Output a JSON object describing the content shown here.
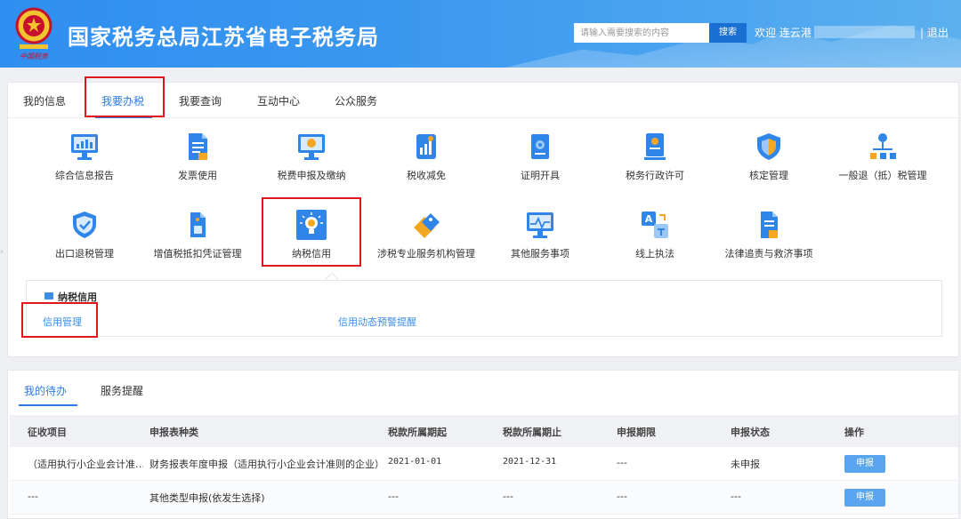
{
  "header": {
    "title": "国家税务总局江苏省电子税务局",
    "search_placeholder": "请输入需要搜索的内容",
    "search_button": "搜索",
    "welcome": "欢迎 连云港",
    "logout": "| 退出",
    "logo_text": "中国税务"
  },
  "nav": {
    "tabs": [
      "我的信息",
      "我要办税",
      "我要查询",
      "互动中心",
      "公众服务"
    ],
    "active": "我要办税"
  },
  "services": [
    {
      "label": "综合信息报告",
      "icon": "monitor-chart-icon"
    },
    {
      "label": "发票使用",
      "icon": "invoice-document-icon"
    },
    {
      "label": "税费申报及缴纳",
      "icon": "declare-monitor-icon"
    },
    {
      "label": "税收减免",
      "icon": "tax-relief-chart-icon"
    },
    {
      "label": "证明开具",
      "icon": "certificate-icon"
    },
    {
      "label": "税务行政许可",
      "icon": "permit-id-icon"
    },
    {
      "label": "核定管理",
      "icon": "shield-check-icon"
    },
    {
      "label": "一般退（抵）税管理",
      "icon": "org-tree-icon"
    },
    {
      "label": "出口退税管理",
      "icon": "shield-icon"
    },
    {
      "label": "增值税抵扣凭证管理",
      "icon": "voucher-doc-icon"
    },
    {
      "label": "纳税信用",
      "icon": "lightbulb-icon"
    },
    {
      "label": "涉税专业服务机构管理",
      "icon": "tags-icon"
    },
    {
      "label": "其他服务事项",
      "icon": "pulse-monitor-icon"
    },
    {
      "label": "线上执法",
      "icon": "translate-icon"
    },
    {
      "label": "法律追责与救济事项",
      "icon": "legal-document-icon"
    }
  ],
  "credit_panel": {
    "title": "纳税信用",
    "links": [
      "信用管理",
      "信用动态预警提醒"
    ]
  },
  "todo": {
    "tabs": [
      "我的待办",
      "服务提醒"
    ],
    "columns": [
      "征收项目",
      "申报表种类",
      "税款所属期起",
      "税款所属期止",
      "申报期限",
      "申报状态",
      "操作"
    ],
    "rows": [
      [
        "（适用执行小企业会计准…",
        "财务报表年度申报（适用执行小企业会计准则的企业）",
        "2021-01-01",
        "2021-12-31",
        "---",
        "未申报",
        "申报"
      ],
      [
        "---",
        "其他类型申报(依发生选择)",
        "---",
        "---",
        "---",
        "---",
        "申报"
      ]
    ]
  },
  "colors": {
    "header_blue": "#2f8ff0",
    "accent_blue": "#2c7be0",
    "highlight_red": "#e0161c",
    "button_blue": "#5aa5ef"
  }
}
